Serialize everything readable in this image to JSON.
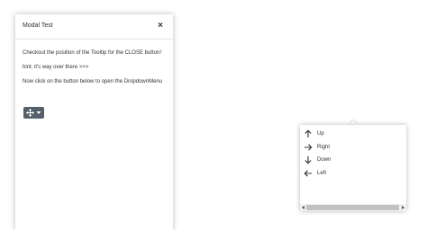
{
  "modal": {
    "title": "Modal Test",
    "close_label": "×",
    "body": [
      "Checkout the position of the Tooltip for the CLOSE button!",
      "hint: it's way over there >>>",
      "Now click on the button below to open the DropdownMenu"
    ],
    "toggle_icon": "move-icon",
    "toggle_caret": "caret-down-icon"
  },
  "dropdown": {
    "items": [
      {
        "label": "Up",
        "icon": "arrow-up-icon"
      },
      {
        "label": "Right",
        "icon": "arrow-right-icon"
      },
      {
        "label": "Down",
        "icon": "arrow-down-icon"
      },
      {
        "label": "Left",
        "icon": "arrow-left-icon"
      }
    ]
  },
  "colors": {
    "button_bg": "#55606a",
    "text": "#333333",
    "scroll_thumb": "#c1c1c1"
  }
}
